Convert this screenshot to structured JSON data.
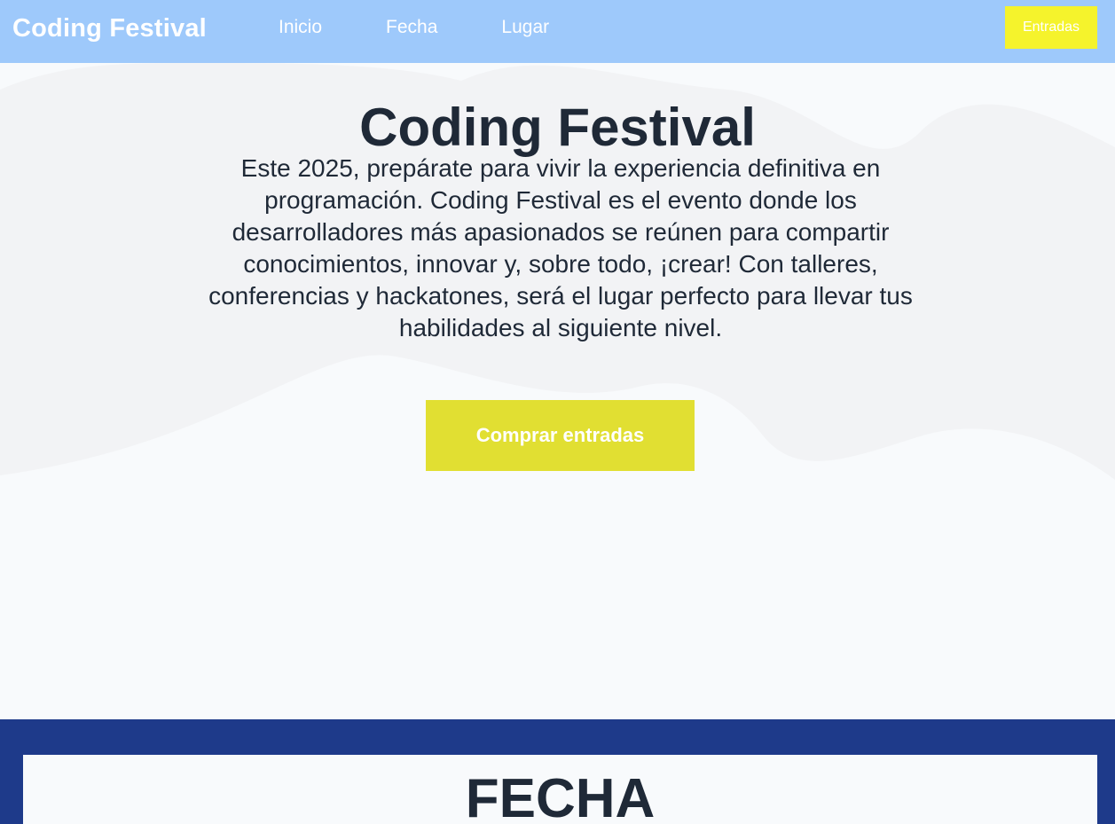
{
  "header": {
    "brand": "Coding Festival",
    "nav": [
      "Inicio",
      "Fecha",
      "Lugar"
    ],
    "tickets_label": "Entradas"
  },
  "hero": {
    "title": "Coding Festival",
    "description": "Este 2025, prepárate para vivir la experiencia definitiva en programación. Coding Festival es el evento donde los desarrolladores más apasionados se reúnen para compartir conocimientos, innovar y, sobre todo, ¡crear! Con talleres, conferencias y hackatones, será el lugar perfecto para llevar tus habilidades al siguiente nivel.",
    "cta_label": "Comprar entradas"
  },
  "date_section": {
    "title": "FECHA"
  },
  "colors": {
    "header_bg": "#9ec9fb",
    "accent_yellow": "#f5f32c",
    "cta_yellow": "#e1df32",
    "section_blue": "#1e3a8a",
    "text_dark": "#1f2937"
  }
}
